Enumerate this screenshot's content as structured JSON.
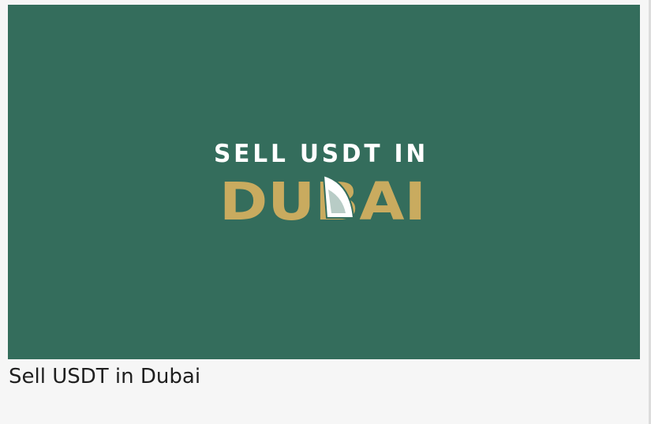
{
  "image": {
    "logo_line1": "SELL USDT IN",
    "logo_line2": "DUBAI",
    "colors": {
      "banner": "#346d5c",
      "gold": "#c9ab5f",
      "white": "#ffffff"
    }
  },
  "caption": "Sell USDT in Dubai"
}
